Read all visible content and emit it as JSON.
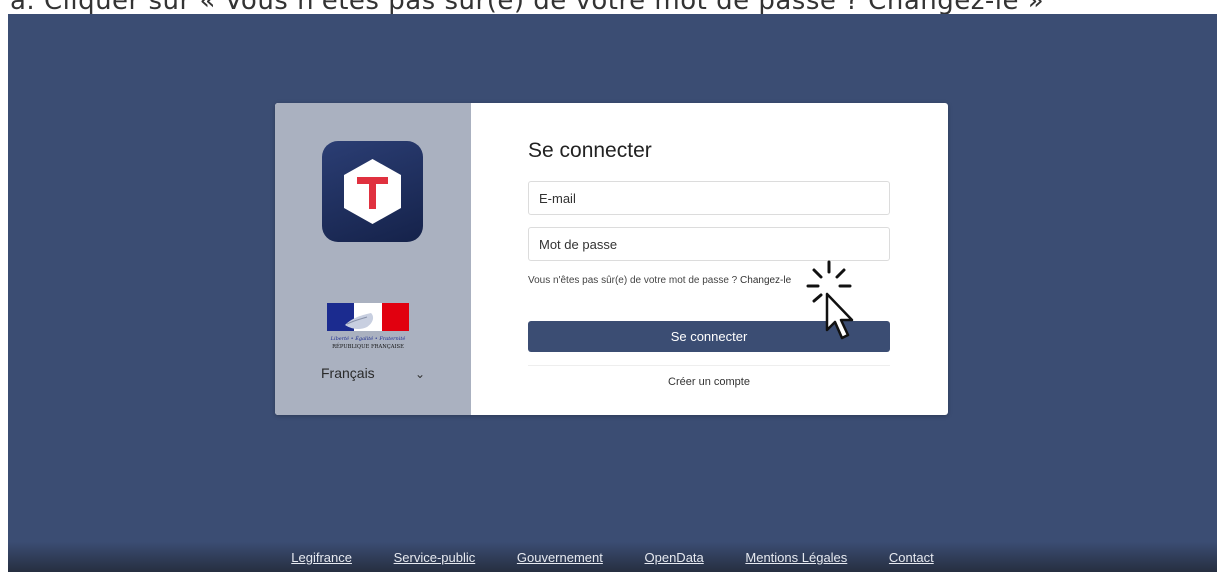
{
  "caption": "a.  Cliquer sur « Vous n'êtes pas sûr(e) de votre mot de passe ? Changez-le »",
  "left_panel": {
    "language": "Français",
    "republic_logo_text": [
      "Liberté • Égalité • Fraternité",
      "RÉPUBLIQUE FRANÇAISE"
    ]
  },
  "login": {
    "title": "Se connecter",
    "email_placeholder": "E-mail",
    "password_placeholder": "Mot de passe",
    "forgot_text": "Vous n'êtes pas sûr(e) de votre mot de passe ? ",
    "forgot_link": "Changez-le",
    "submit_label": "Se connecter",
    "create_account": "Créer un compte"
  },
  "footer": {
    "links": [
      "Legifrance",
      "Service-public",
      "Gouvernement",
      "OpenData",
      "Mentions Légales",
      "Contact"
    ]
  },
  "colors": {
    "background": "#3b4d73",
    "left_panel": "#aab1c0",
    "button": "#3b4d73",
    "logo_t": "#e0313f"
  },
  "icons": [
    "app-logo-icon",
    "marianne-logo",
    "chevron-down-icon",
    "pointer-cursor-icon"
  ]
}
